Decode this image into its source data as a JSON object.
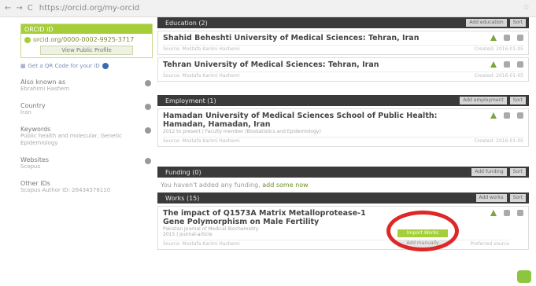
{
  "browser": {
    "url": "https://orcid.org/my-orcid"
  },
  "sidebar": {
    "orcid_label": "ORCID iD",
    "orcid_link": "orcid.org/0000-0002-9925-3717",
    "view_public": "View Public Profile",
    "qr_label": "Get a QR Code for your iD",
    "sections": [
      {
        "heading": "Also known as",
        "value": "Ebrahimi Hashem"
      },
      {
        "heading": "Country",
        "value": "Iran"
      },
      {
        "heading": "Keywords",
        "value": "Public health and molecular, Genetic Epidemiology"
      },
      {
        "heading": "Websites",
        "value": "Scopus"
      },
      {
        "heading": "Other IDs",
        "value": "Scopus Author ID: 26434376110"
      }
    ]
  },
  "education": {
    "title": "Education (2)",
    "add_label": "Add education",
    "sort_label": "Sort",
    "items": [
      {
        "title": "Shahid Beheshti University of Medical Sciences: Tehran, Iran",
        "source": "Source: Mostafa Karimi Hashemi",
        "created": "Created: 2016-01-05"
      },
      {
        "title": "Tehran University of Medical Sciences: Tehran, Iran",
        "source": "Source: Mostafa Karimi Hashemi",
        "created": "Created: 2016-01-05"
      }
    ]
  },
  "employment": {
    "title": "Employment (1)",
    "add_label": "Add employment",
    "sort_label": "Sort",
    "items": [
      {
        "title": "Hamadan University of Medical Sciences School of Public Health: Hamadan, Hamadan, Iran",
        "subtitle": "2012 to present | Faculty member (Biostatistics and Epidemiology)",
        "source": "Source: Mostafa Karimi Hashemi",
        "created": "Created: 2016-01-05"
      }
    ]
  },
  "funding": {
    "title": "Funding (0)",
    "add_label": "Add funding",
    "sort_label": "Sort",
    "empty_text": "You haven't added any funding,",
    "empty_link": "add some now"
  },
  "works": {
    "title": "Works (15)",
    "add_label": "Add works",
    "sort_label": "Sort",
    "items": [
      {
        "title": "The impact of Q1573A Matrix Metalloprotease-1 Gene Polymorphism on Male Fertility",
        "subtitle": "Pakistan Journal of Medical Biochemistry",
        "year": "2015 | journal-article",
        "source": "Source: Mostafa Karimi Hashemi",
        "preferred": "Preferred source"
      }
    ],
    "popup_primary": "Import Works",
    "popup_secondary": "Add manually"
  }
}
